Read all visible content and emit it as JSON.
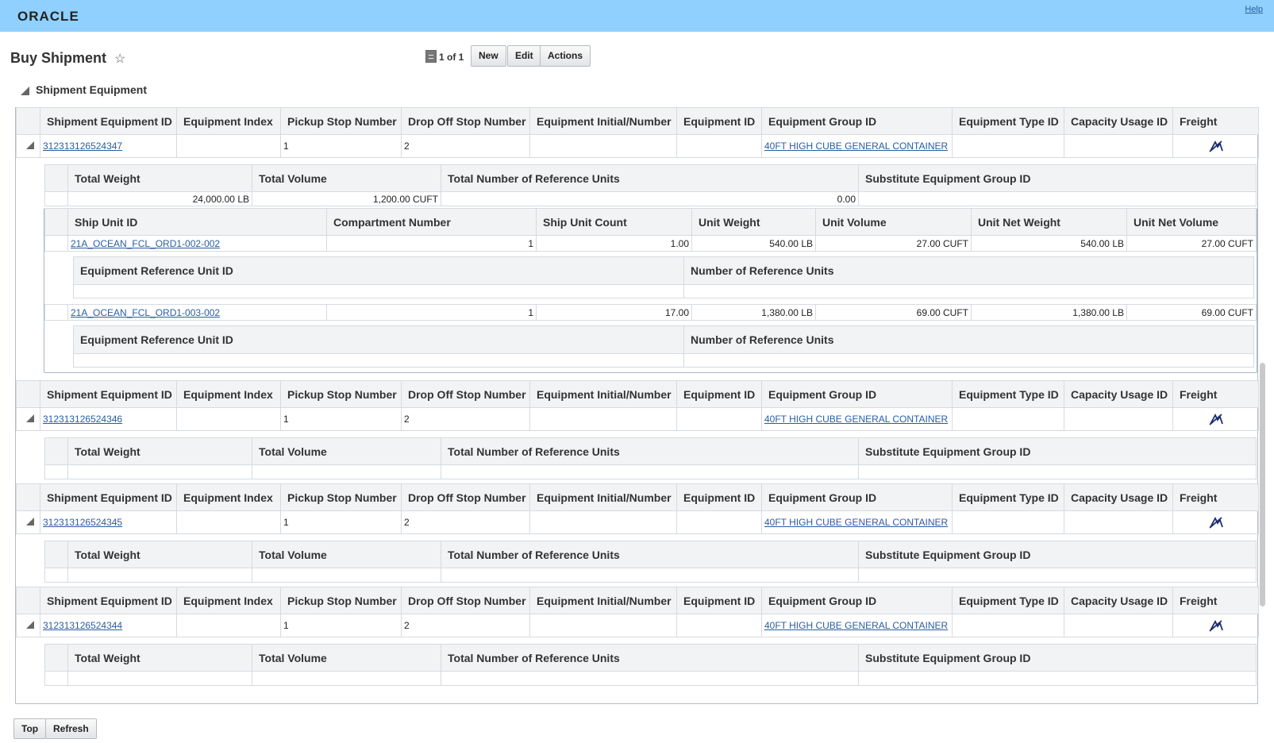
{
  "header": {
    "logo": "ORACLE",
    "help_link": "Help"
  },
  "page": {
    "title": "Buy Shipment"
  },
  "pager": {
    "text": "1 of 1"
  },
  "toolbar": {
    "new_label": "New",
    "edit_label": "Edit",
    "actions_label": "Actions"
  },
  "section": {
    "title": "Shipment Equipment"
  },
  "equipment_headers": [
    "Shipment Equipment ID",
    "Equipment Index",
    "Pickup Stop Number",
    "Drop Off Stop Number",
    "Equipment Initial/Number",
    "Equipment ID",
    "Equipment Group ID",
    "Equipment Type ID",
    "Capacity Usage ID",
    "Freight"
  ],
  "totals_headers": [
    "Total Weight",
    "Total Volume",
    "Total Number of Reference Units",
    "Substitute Equipment Group ID"
  ],
  "ship_unit_headers": [
    "Ship Unit ID",
    "Compartment Number",
    "Ship Unit Count",
    "Unit Weight",
    "Unit Volume",
    "Unit Net Weight",
    "Unit Net Volume"
  ],
  "ref_unit_headers": [
    "Equipment Reference Unit ID",
    "Number of Reference Units"
  ],
  "equipment": [
    {
      "id": "312313126524347",
      "index": "",
      "pickup_stop": "1",
      "dropoff_stop": "2",
      "initial_number": "",
      "equipment_id": "",
      "group_id": "40FT HIGH CUBE GENERAL CONTAINER",
      "type_id": "",
      "capacity_usage_id": "",
      "freight_icon": "freight-icon",
      "totals": {
        "total_weight": "24,000.00 LB",
        "total_volume": "1,200.00 CUFT",
        "total_ref_units": "0.00",
        "substitute_group": ""
      },
      "ship_units": [
        {
          "id": "21A_OCEAN_FCL_ORD1-002-002",
          "compartment": "1",
          "count": "1.00",
          "unit_weight": "540.00 LB",
          "unit_volume": "27.00 CUFT",
          "unit_net_weight": "540.00 LB",
          "unit_net_volume": "27.00 CUFT"
        },
        {
          "id": "21A_OCEAN_FCL_ORD1-003-002",
          "compartment": "1",
          "count": "17.00",
          "unit_weight": "1,380.00 LB",
          "unit_volume": "69.00 CUFT",
          "unit_net_weight": "1,380.00 LB",
          "unit_net_volume": "69.00 CUFT"
        }
      ]
    },
    {
      "id": "312313126524346",
      "index": "",
      "pickup_stop": "1",
      "dropoff_stop": "2",
      "initial_number": "",
      "equipment_id": "",
      "group_id": "40FT HIGH CUBE GENERAL CONTAINER",
      "type_id": "",
      "capacity_usage_id": "",
      "freight_icon": "freight-icon",
      "totals": {
        "total_weight": "",
        "total_volume": "",
        "total_ref_units": "",
        "substitute_group": ""
      }
    },
    {
      "id": "312313126524345",
      "index": "",
      "pickup_stop": "1",
      "dropoff_stop": "2",
      "initial_number": "",
      "equipment_id": "",
      "group_id": "40FT HIGH CUBE GENERAL CONTAINER",
      "type_id": "",
      "capacity_usage_id": "",
      "freight_icon": "freight-icon",
      "totals": {
        "total_weight": "",
        "total_volume": "",
        "total_ref_units": "",
        "substitute_group": ""
      }
    },
    {
      "id": "312313126524344",
      "index": "",
      "pickup_stop": "1",
      "dropoff_stop": "2",
      "initial_number": "",
      "equipment_id": "",
      "group_id": "40FT HIGH CUBE GENERAL CONTAINER",
      "type_id": "",
      "capacity_usage_id": "",
      "freight_icon": "freight-icon",
      "totals": {
        "total_weight": "",
        "total_volume": "",
        "total_ref_units": "",
        "substitute_group": ""
      }
    }
  ],
  "footer": {
    "top_label": "Top",
    "refresh_label": "Refresh"
  },
  "colors": {
    "header_bar": "#8fd0fe",
    "link": "#2a5d9f",
    "table_header_bg": "#f2f3f5",
    "border": "#d6dbe0"
  }
}
